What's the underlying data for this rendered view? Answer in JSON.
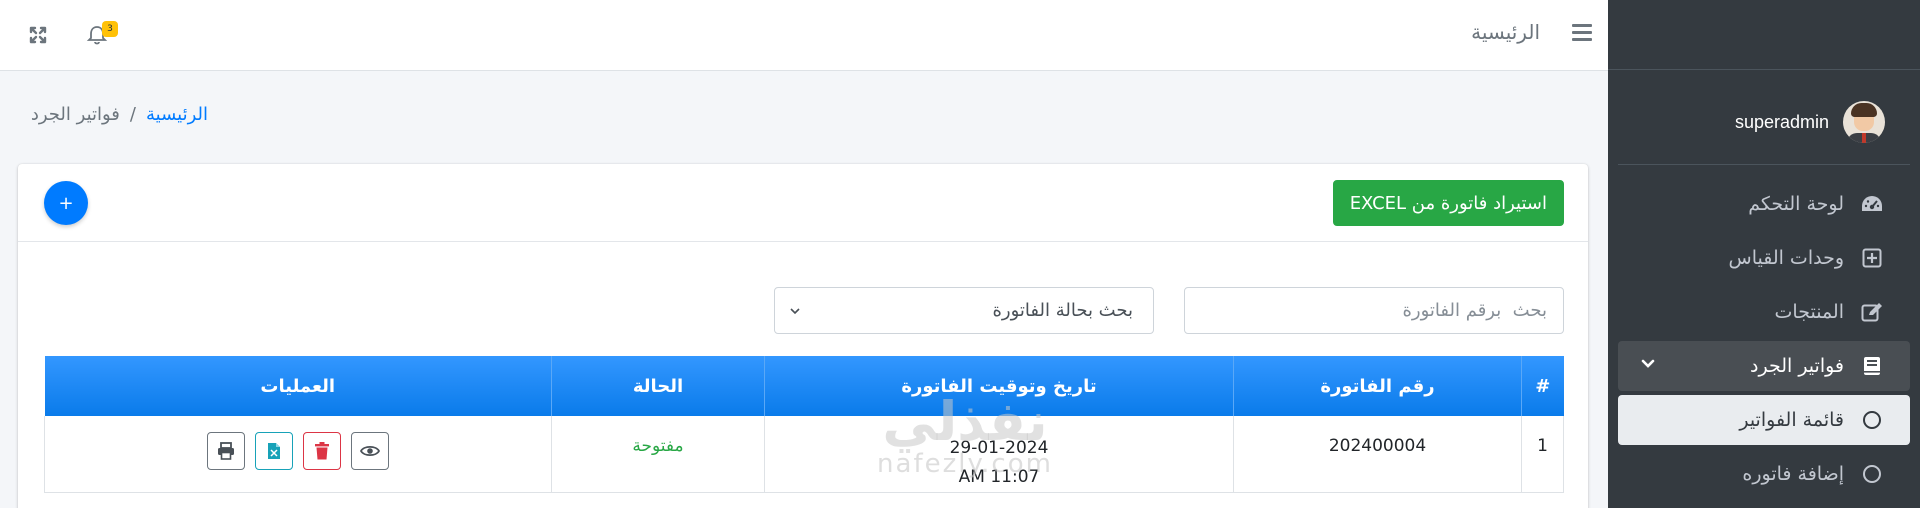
{
  "topbar": {
    "home_link": "الرئيسية",
    "notification_count": "3"
  },
  "sidebar": {
    "username": "superadmin",
    "items": [
      {
        "label": "لوحة التحكم",
        "icon": "dashboard-icon"
      },
      {
        "label": "وحدات القياس",
        "icon": "plus-square-icon"
      },
      {
        "label": "المنتجات",
        "icon": "edit-icon"
      },
      {
        "label": "فواتير الجرد",
        "icon": "book-icon"
      },
      {
        "label": "قائمة الفواتير",
        "icon": "circle-icon"
      },
      {
        "label": "إضافة فاتوره",
        "icon": "circle-icon"
      }
    ]
  },
  "breadcrumb": {
    "home": "الرئيسية",
    "separator": "/",
    "current": "فواتير الجرد"
  },
  "card": {
    "import_button": "استيراد فاتورة من EXCEL",
    "add_button": "+",
    "search_placeholder": "بحث  برقم الفاتورة",
    "status_filter": "بحث بحالة الفاتورة"
  },
  "table": {
    "headers": {
      "index": "#",
      "number": "رقم الفاتورة",
      "datetime": "تاريخ وتوقيت الفاتورة",
      "status": "الحالة",
      "actions": "العمليات"
    },
    "rows": [
      {
        "index": "1",
        "number": "202400004",
        "date": "29-01-2024",
        "time": "AM 11:07",
        "status": "مفتوحة"
      }
    ]
  },
  "watermark": {
    "arabic": "نفذلي",
    "latin": "nafezly.com"
  },
  "colors": {
    "sidebar_bg": "#343a40",
    "primary": "#007bff",
    "success": "#28a745",
    "danger": "#dc3545",
    "info": "#17a2b8",
    "table_header": "#1e88f5"
  }
}
